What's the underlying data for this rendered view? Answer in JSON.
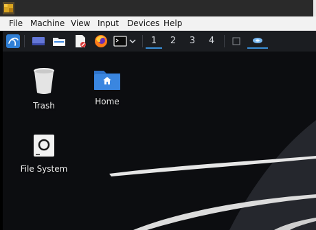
{
  "window": {
    "menu": [
      "File",
      "Machine",
      "View",
      "Input",
      "Devices",
      "Help"
    ]
  },
  "panel": {
    "launchers": [
      "kali-menu-icon",
      "show-desktop-icon",
      "file-manager-icon",
      "text-editor-icon",
      "firefox-icon",
      "terminal-icon"
    ],
    "workspaces": [
      "1",
      "2",
      "3",
      "4"
    ],
    "active_workspace": "1"
  },
  "desktop": {
    "icons": [
      {
        "label": "Trash",
        "icon": "trash-icon"
      },
      {
        "label": "Home",
        "icon": "home-folder-icon"
      },
      {
        "label": "File System",
        "icon": "drive-icon"
      }
    ]
  },
  "colors": {
    "accent": "#3a8fd9",
    "panel_bg": "#1b1d21",
    "desktop_bg": "#0c0d10",
    "folder_blue": "#3a86e0",
    "kali_blue": "#2f7fd6"
  }
}
